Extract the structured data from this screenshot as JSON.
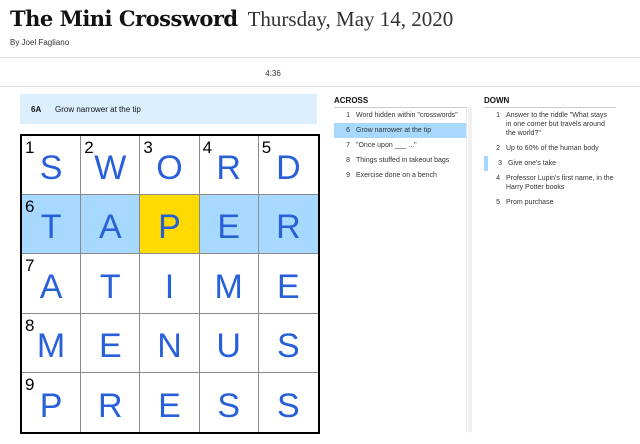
{
  "header": {
    "title": "The Mini Crossword",
    "date": "Thursday, May 14, 2020",
    "byline": "By Joel Fagliano"
  },
  "timer": "4:36",
  "active_clue": {
    "number": "6A",
    "text": "Grow narrower at the tip"
  },
  "grid": {
    "rows": [
      [
        {
          "n": "1",
          "l": "S"
        },
        {
          "n": "2",
          "l": "W"
        },
        {
          "n": "3",
          "l": "O"
        },
        {
          "n": "4",
          "l": "R"
        },
        {
          "n": "5",
          "l": "D"
        }
      ],
      [
        {
          "n": "6",
          "l": "T"
        },
        {
          "n": "",
          "l": "A"
        },
        {
          "n": "",
          "l": "P"
        },
        {
          "n": "",
          "l": "E"
        },
        {
          "n": "",
          "l": "R"
        }
      ],
      [
        {
          "n": "7",
          "l": "A"
        },
        {
          "n": "",
          "l": "T"
        },
        {
          "n": "",
          "l": "I"
        },
        {
          "n": "",
          "l": "M"
        },
        {
          "n": "",
          "l": "E"
        }
      ],
      [
        {
          "n": "8",
          "l": "M"
        },
        {
          "n": "",
          "l": "E"
        },
        {
          "n": "",
          "l": "N"
        },
        {
          "n": "",
          "l": "U"
        },
        {
          "n": "",
          "l": "S"
        }
      ],
      [
        {
          "n": "9",
          "l": "P"
        },
        {
          "n": "",
          "l": "R"
        },
        {
          "n": "",
          "l": "E"
        },
        {
          "n": "",
          "l": "S"
        },
        {
          "n": "",
          "l": "S"
        }
      ]
    ],
    "highlight_row": 1,
    "selected_col": 2,
    "colors": {
      "word": "#a7d8ff",
      "selected": "#ffda00",
      "letter": "#2860d8"
    }
  },
  "across": {
    "heading": "ACROSS",
    "clues": [
      {
        "n": "1",
        "text": "Word hidden within \"crosswords\""
      },
      {
        "n": "6",
        "text": "Grow narrower at the tip"
      },
      {
        "n": "7",
        "text": "\"Once upon ___ ...\""
      },
      {
        "n": "8",
        "text": "Things stuffed in takeout bags"
      },
      {
        "n": "9",
        "text": "Exercise done on a bench"
      }
    ]
  },
  "down": {
    "heading": "DOWN",
    "clues": [
      {
        "n": "1",
        "text": "Answer to the riddle \"What stays in one corner but travels around the world?\""
      },
      {
        "n": "2",
        "text": "Up to 60% of the human body"
      },
      {
        "n": "3",
        "text": "Give one's take"
      },
      {
        "n": "4",
        "text": "Professor Lupin's first name, in the Harry Potter books"
      },
      {
        "n": "5",
        "text": "Prom purchase"
      }
    ]
  }
}
